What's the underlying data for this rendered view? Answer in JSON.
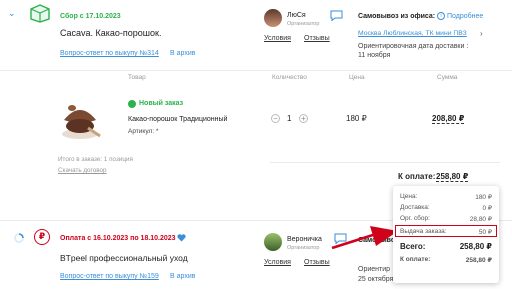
{
  "order1": {
    "status": "Сбор с 17.10.2023",
    "title": "Cacava. Какао-порошок.",
    "qa_link": "Вопрос-ответ по выкупу №314",
    "archive_link": "В архив",
    "organizer": {
      "name": "ЛюСя",
      "role": "Организатор",
      "conditions": "Условия",
      "reviews": "Отзывы"
    },
    "pickup": {
      "label": "Самовывоз из офиса:",
      "details": "Подробнее",
      "address": "Москва Люблинская, ТК мини ПВЗ",
      "delivery_label": "Ориентировочная дата доставки :",
      "delivery_date": "11 ноября"
    },
    "table": {
      "headers": [
        "Товар",
        "Количество",
        "Цена",
        "Сумма"
      ],
      "item": {
        "status": "Новый заказ",
        "name": "Какао-порошок Традиционный",
        "article": "Артикул: *",
        "qty": "1",
        "price": "180 ₽",
        "sum": "208,80 ₽"
      }
    },
    "total_items": "Итого в заказе: 1 позиция",
    "download": "Скачать договор",
    "pay_label": "К оплате:",
    "pay_value": "258,80 ₽"
  },
  "popup": {
    "rows": [
      {
        "label": "Цена:",
        "value": "180 ₽"
      },
      {
        "label": "Доставка:",
        "value": "0 ₽"
      },
      {
        "label": "Орг. сбор:",
        "value": "28,80 ₽"
      },
      {
        "label": "Выдача заказа:",
        "value": "50 ₽"
      }
    ],
    "total_label": "Всего:",
    "total_value": "258,80 ₽",
    "pay_label": "К оплате:",
    "pay_value": "258,80 ₽"
  },
  "order2": {
    "status": "Оплата с 16.10.2023 по 18.10.2023",
    "title": "BTpeel профессиональный уход",
    "qa_link": "Вопрос-ответ по выкупу №159",
    "archive_link": "В архив",
    "organizer": {
      "name": "Вероничка",
      "role": "Организатор",
      "conditions": "Условия",
      "reviews": "Отзывы"
    },
    "pickup_label": "Самовыво",
    "delivery_partial": "Ориентир",
    "delivery_date_partial": "25 октября"
  },
  "colors": {
    "accent": "#3a8fd8",
    "green": "#2bb24c",
    "red": "#d0021b"
  }
}
